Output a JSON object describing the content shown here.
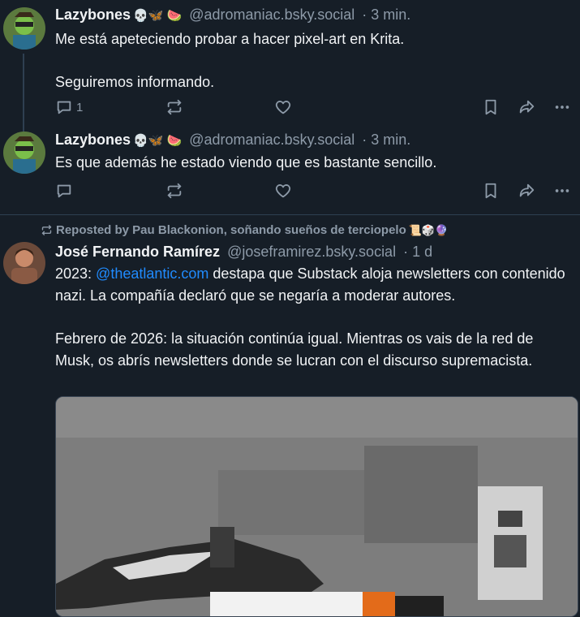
{
  "posts": [
    {
      "author": "Lazybones",
      "author_emoji": "💀🦋 🍉",
      "handle": "@adromaniac.bsky.social",
      "time": "· 3 min.",
      "text_lines": [
        "Me está apeteciendo probar a hacer pixel-art en Krita.",
        "Seguiremos informando."
      ],
      "reply_count": "1"
    },
    {
      "author": "Lazybones",
      "author_emoji": "💀🦋 🍉",
      "handle": "@adromaniac.bsky.social",
      "time": "· 3 min.",
      "text_lines": [
        "Es que además he estado viendo que es bastante sencillo."
      ],
      "reply_count": ""
    },
    {
      "repost_by": "Reposted by Pau Blackonion, soñando sueños de terciopelo",
      "repost_emoji": "📜🎲🔮",
      "author": "José Fernando Ramírez",
      "handle": "@joseframirez.bsky.social",
      "time": "· 1 d",
      "para1_prefix": "2023: ",
      "para1_mention": "@theatlantic.com",
      "para1_rest": " destapa que Substack aloja newsletters con contenido nazi. La compañía declaró que se negaría a moderar autores.",
      "para2": "Febrero de 2026: la situación continúa igual. Mientras os vais de la red de Musk, os abrís newsletters donde se lucran con el discurso supremacista."
    }
  ],
  "icons": {
    "reply": "reply-icon",
    "repost": "repost-icon",
    "like": "heart-icon",
    "bookmark": "bookmark-icon",
    "share": "share-icon",
    "more": "more-icon"
  },
  "colors": {
    "background": "#161e27",
    "text": "#f1f3f5",
    "muted": "#8d9aa8",
    "link": "#208bfe",
    "border": "#2e3f51"
  }
}
